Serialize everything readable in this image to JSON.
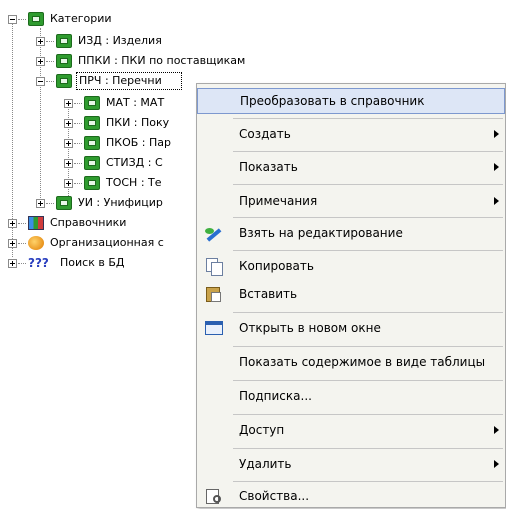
{
  "tree": {
    "root": "Категории",
    "children": [
      "ИЗД : Изделия",
      "ППКИ : ПКИ по поставщикам",
      "ПРЧ : Перечни"
    ],
    "prch_children": [
      "МАТ : МАТ",
      "ПКИ : Поку",
      "ПКОБ : Пар",
      "СТИЗД : С",
      "ТОСН : Те"
    ],
    "ui_item": "УИ : Унифицир",
    "other_roots": [
      "Справочники",
      "Организационная с",
      "Поиск в БД"
    ],
    "search_icon_glyph": "???"
  },
  "menu": {
    "items": [
      "Преобразовать в справочник",
      "Создать",
      "Показать",
      "Примечания",
      "Взять на редактирование",
      "Копировать",
      "Вставить",
      "Открыть в новом окне",
      "Показать содержимое в виде таблицы",
      "Подписка...",
      "Доступ",
      "Удалить",
      "Свойства..."
    ],
    "highlight_color": "#dde6f6"
  }
}
